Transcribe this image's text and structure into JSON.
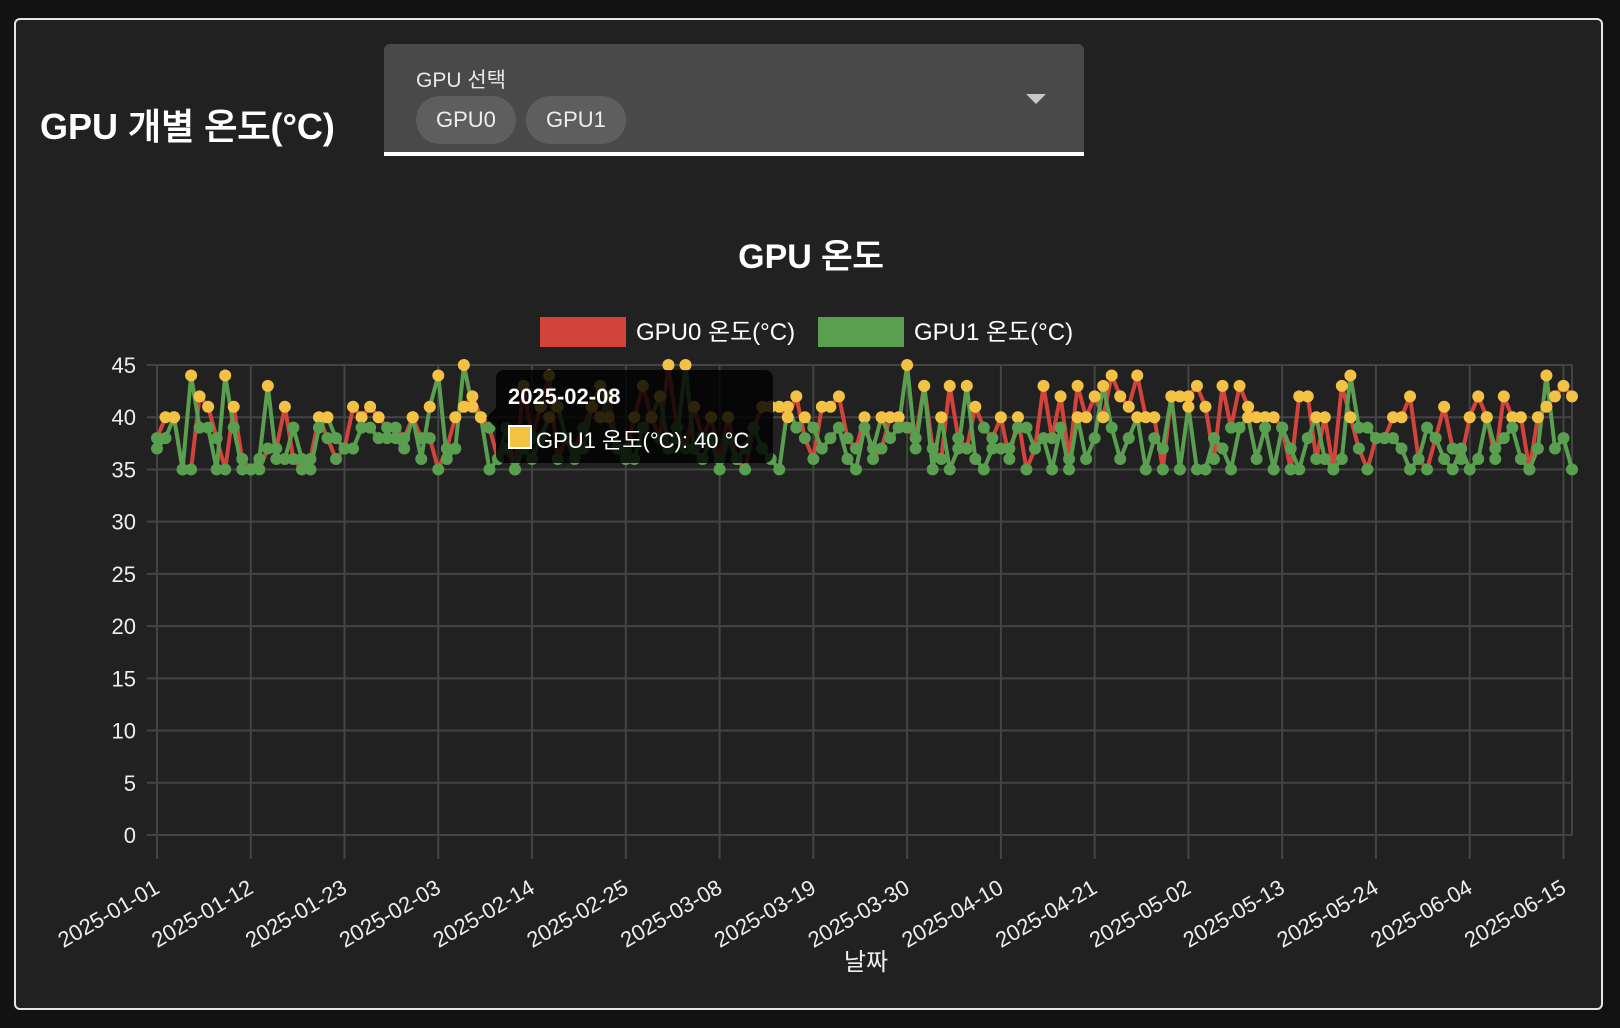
{
  "header": {
    "title": "GPU 개별 온도(°C)"
  },
  "gpu_select": {
    "label": "GPU 선택",
    "chips": [
      "GPU0",
      "GPU1"
    ],
    "dropdown_icon": "triangle-down"
  },
  "tooltip": {
    "title": "2025-02-08",
    "body": "GPU1 온도(°C): 40 °C",
    "swatch_color": "#f3c244"
  },
  "chart_data": {
    "type": "line",
    "title": "GPU 온도",
    "xlabel": "날짜",
    "ylabel": "",
    "ylim": [
      0,
      45
    ],
    "y_ticks": [
      "0",
      "5",
      "10",
      "15",
      "20",
      "25",
      "30",
      "35",
      "40",
      "45"
    ],
    "start_date": "2025-01-01",
    "x_tick_labels": [
      "2025-01-01",
      "2025-01-12",
      "2025-01-23",
      "2025-02-03",
      "2025-02-14",
      "2025-02-25",
      "2025-03-08",
      "2025-03-19",
      "2025-03-30",
      "2025-04-10",
      "2025-04-21",
      "2025-05-02",
      "2025-05-13",
      "2025-05-24",
      "2025-06-04",
      "2025-06-15"
    ],
    "x_tick_step_days": 11,
    "grid": true,
    "legend": "top-center",
    "point_threshold": 40,
    "point_color_high": "#f3c244",
    "point_color_low": "#5a9e4f",
    "series": [
      {
        "name": "GPU0 온도(°C)",
        "color": "#d2443b",
        "values": [
          38,
          40,
          40,
          35,
          35,
          42,
          41,
          38,
          35,
          41,
          36,
          35,
          35,
          37,
          37,
          41,
          36,
          35,
          36,
          40,
          38,
          36,
          37,
          41,
          40,
          41,
          40,
          39,
          39,
          38,
          40,
          38,
          38,
          35,
          37,
          40,
          41,
          42,
          40,
          39,
          36,
          37,
          35,
          43,
          38,
          41,
          44,
          36,
          38,
          37,
          39,
          41,
          40,
          42,
          37,
          36,
          40,
          43,
          40,
          38,
          45,
          39,
          37,
          41,
          38,
          40,
          36,
          40,
          36,
          35,
          39,
          41,
          41,
          41,
          40,
          42,
          38,
          36,
          41,
          41,
          42,
          38,
          37,
          40,
          36,
          37,
          40,
          40,
          39,
          38,
          43,
          37,
          36,
          43,
          38,
          37,
          41,
          39,
          38,
          40,
          36,
          40,
          35,
          37,
          43,
          38,
          42,
          36,
          43,
          40,
          42,
          40,
          44,
          42,
          41,
          44,
          40,
          40,
          35,
          42,
          42,
          42,
          43,
          41,
          36,
          43,
          39,
          43,
          41,
          40,
          40,
          40,
          39,
          35,
          42,
          42,
          36,
          40,
          35,
          43,
          40,
          37,
          35,
          38,
          38,
          40,
          40,
          42,
          36,
          35,
          38,
          41,
          37,
          36,
          40,
          42,
          40,
          36,
          42,
          40,
          40,
          35,
          40,
          41,
          42,
          43,
          42
        ]
      },
      {
        "name": "GPU1 온도(°C)",
        "color": "#5a9e4f",
        "values": [
          37,
          38,
          40,
          35,
          44,
          39,
          39,
          35,
          44,
          39,
          35,
          35,
          36,
          43,
          36,
          36,
          39,
          36,
          35,
          39,
          40,
          38,
          37,
          37,
          39,
          39,
          38,
          38,
          38,
          37,
          40,
          36,
          41,
          44,
          36,
          37,
          45,
          41,
          40,
          35,
          36,
          39,
          35,
          37,
          36,
          38,
          40,
          41,
          38,
          36,
          37,
          41,
          43,
          40,
          37,
          37,
          36,
          39,
          40,
          42,
          37,
          38,
          45,
          37,
          36,
          38,
          35,
          38,
          36,
          37,
          39,
          37,
          36,
          35,
          41,
          39,
          40,
          39,
          37,
          38,
          39,
          36,
          35,
          39,
          37,
          40,
          38,
          39,
          45,
          37,
          43,
          35,
          40,
          35,
          37,
          43,
          36,
          35,
          37,
          37,
          37,
          39,
          39,
          37,
          38,
          35,
          39,
          35,
          40,
          36,
          38,
          43,
          39,
          36,
          38,
          40,
          35,
          38,
          37,
          42,
          35,
          41,
          35,
          35,
          38,
          37,
          35,
          39,
          40,
          36,
          39,
          35,
          39,
          37,
          35,
          38,
          40,
          36,
          35,
          36,
          44,
          39,
          39,
          38,
          38,
          38,
          37,
          35,
          36,
          39,
          38,
          36,
          35,
          37,
          35,
          36,
          40,
          37,
          38,
          39,
          36,
          35,
          37,
          44,
          37,
          38,
          35
        ]
      }
    ]
  }
}
